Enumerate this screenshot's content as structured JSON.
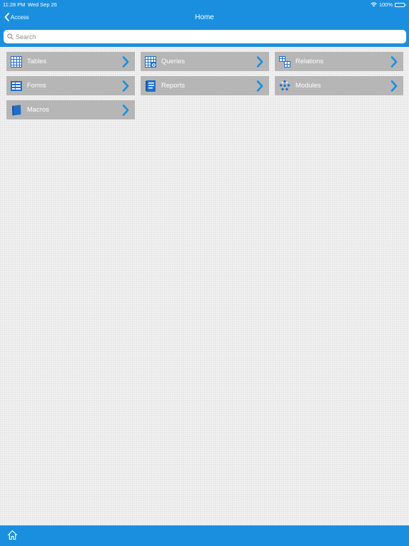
{
  "status_bar": {
    "time": "11:28 PM",
    "date": "Wed Sep 26",
    "battery": "100%"
  },
  "nav": {
    "back_label": "Access",
    "title": "Home"
  },
  "search": {
    "placeholder": "Search"
  },
  "tiles": [
    {
      "label": "Tables",
      "icon": "tables-icon"
    },
    {
      "label": "Queries",
      "icon": "queries-icon"
    },
    {
      "label": "Relations",
      "icon": "relations-icon"
    },
    {
      "label": "Forms",
      "icon": "forms-icon"
    },
    {
      "label": "Reports",
      "icon": "reports-icon"
    },
    {
      "label": "Modules",
      "icon": "modules-icon"
    },
    {
      "label": "Macros",
      "icon": "macros-icon"
    }
  ],
  "colors": {
    "accent": "#1a8fe0",
    "tile_bg": "#b6b6b6",
    "chevron": "#1a8fe0"
  }
}
